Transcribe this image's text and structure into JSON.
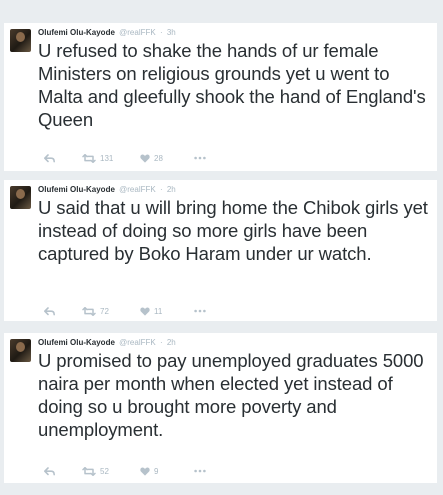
{
  "tweets": [
    {
      "author": "Olufemi Olu-Kayode",
      "handle": "@realFFK",
      "separator": "·",
      "time": "3h",
      "text": "U refused to shake the hands of ur female Ministers on religious grounds yet u went to Malta and gleefully shook the hand of England's Queen",
      "retweets": "131",
      "likes": "28"
    },
    {
      "author": "Olufemi Olu-Kayode",
      "handle": "@realFFK",
      "separator": "·",
      "time": "2h",
      "text": "U said that u will bring home the Chibok girls yet instead of doing so more girls have been captured by Boko Haram under ur watch.",
      "retweets": "72",
      "likes": "11"
    },
    {
      "author": "Olufemi Olu-Kayode",
      "handle": "@realFFK",
      "separator": "·",
      "time": "2h",
      "text": "U promised to pay unemployed graduates 5000 naira per month when elected yet instead of doing so u brought more poverty and unemployment.",
      "retweets": "52",
      "likes": "9"
    }
  ],
  "icons": {
    "reply": "reply-icon",
    "retweet": "retweet-icon",
    "like": "heart-icon",
    "more": "more-dots-icon"
  },
  "colors": {
    "background": "#e9edf0",
    "card": "#ffffff",
    "text": "#292f33",
    "muted": "#aab8c2"
  }
}
